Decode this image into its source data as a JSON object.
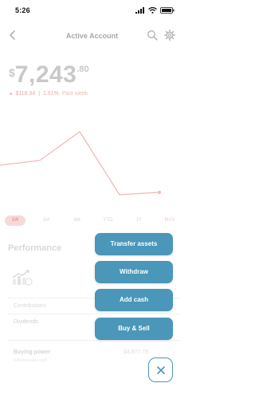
{
  "status_bar": {
    "time": "5:26"
  },
  "header": {
    "title": "Active Account"
  },
  "balance": {
    "currency": "$",
    "main": "7,243",
    "cents": ".80"
  },
  "change": {
    "amount": "$118.34",
    "percent": "1.61%",
    "period": "Past week",
    "direction": "up"
  },
  "range_tabs": [
    "1W",
    "1M",
    "6M",
    "YTD",
    "1Y",
    "MAX"
  ],
  "performance": {
    "title": "Performance",
    "contributions_label": "Contributions",
    "dividends_label": "Dividends"
  },
  "buying_power": {
    "label": "Buying power",
    "sub": "Withdrawable cash",
    "value": "$4,877.78"
  },
  "actions": {
    "transfer": "Transfer assets",
    "withdraw": "Withdraw",
    "add_cash": "Add cash",
    "buy_sell": "Buy & Sell"
  },
  "colors": {
    "accent": "#4a97b9",
    "chart_line": "#f2b9b9"
  }
}
